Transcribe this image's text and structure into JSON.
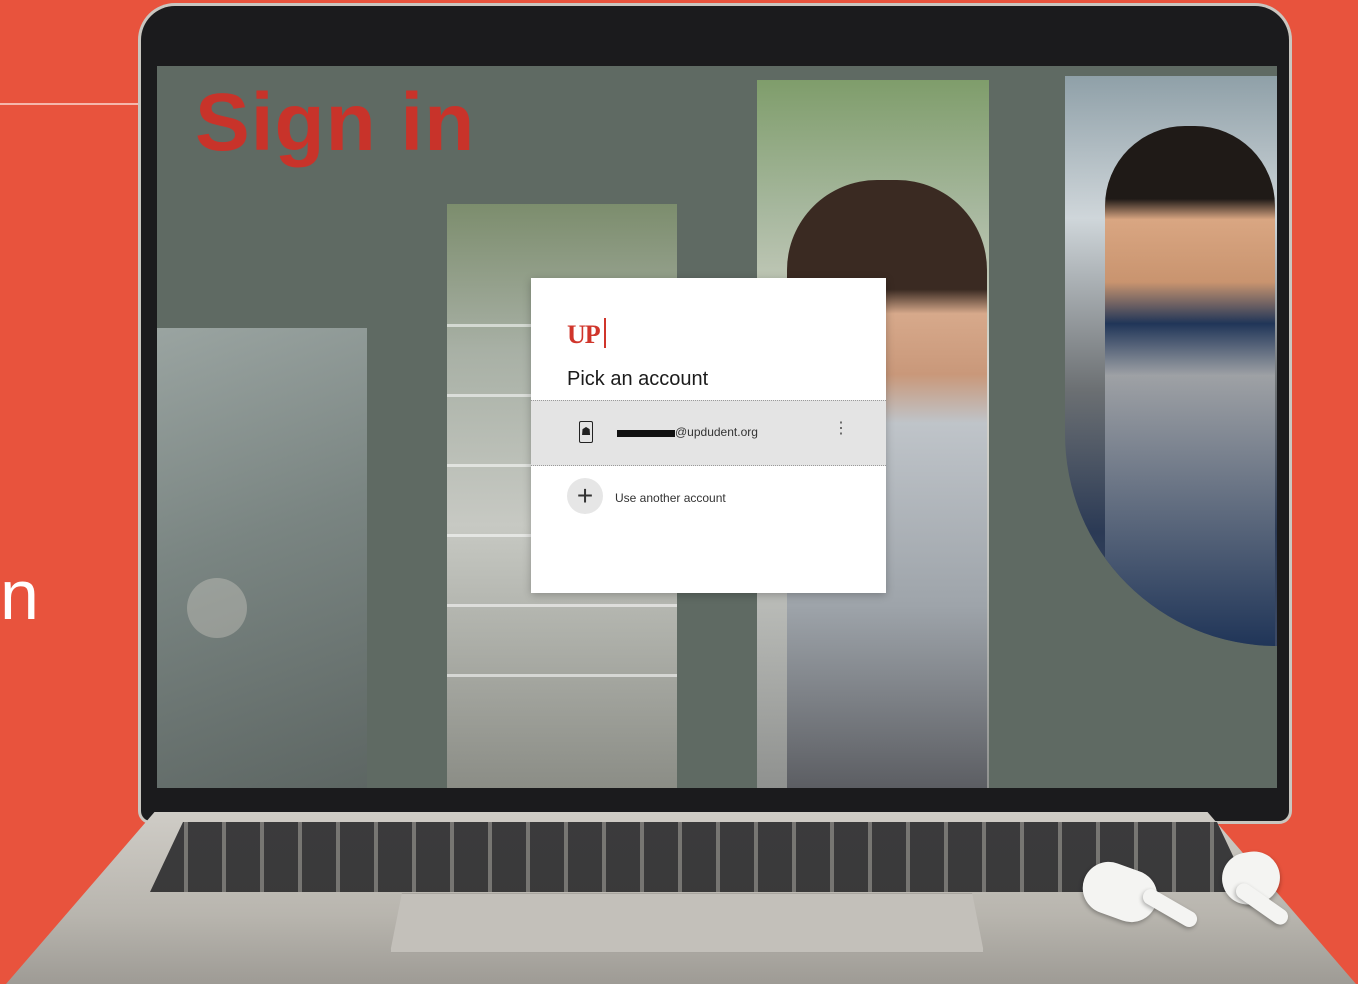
{
  "background_color": "#e8533d",
  "side_text": "n",
  "screen": {
    "heading": "Sign in",
    "dialog": {
      "logo_text": "UP",
      "title": "Pick an account",
      "account": {
        "email_suffix": "@updudent.org",
        "icon": "badge-icon",
        "more_icon": "vertical-ellipsis-icon"
      },
      "add_account": {
        "icon": "plus-icon",
        "label": "Use another account"
      }
    }
  },
  "brand_color": "#d0352b"
}
